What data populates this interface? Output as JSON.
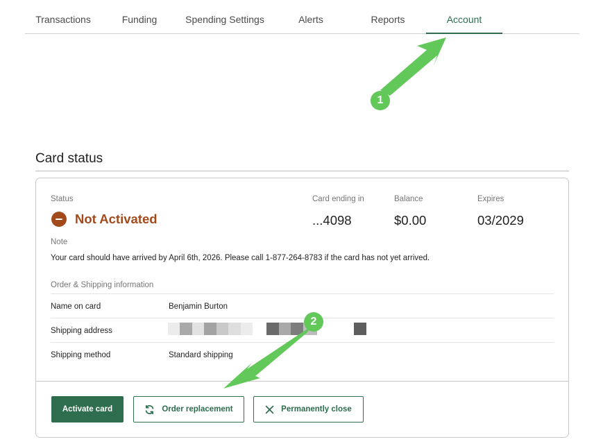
{
  "tabs": [
    {
      "label": "Transactions"
    },
    {
      "label": "Funding"
    },
    {
      "label": "Spending Settings"
    },
    {
      "label": "Alerts"
    },
    {
      "label": "Reports"
    },
    {
      "label": "Account",
      "active": true
    }
  ],
  "section_title": "Card status",
  "card": {
    "status_label": "Status",
    "status_value": "Not Activated",
    "card_ending_label": "Card ending in",
    "card_ending_value": "...4098",
    "balance_label": "Balance",
    "balance_value": "$0.00",
    "expires_label": "Expires",
    "expires_value": "03/2029",
    "note_label": "Note",
    "note_text": "Your card should have arrived by April 6th, 2026. Please call 1-877-264-8783 if the card has not yet arrived.",
    "order_label": "Order & Shipping information",
    "rows": [
      {
        "key": "Name on card",
        "value": "Benjamin Burton"
      },
      {
        "key": "Shipping address",
        "value": ""
      },
      {
        "key": "Shipping method",
        "value": "Standard shipping"
      }
    ]
  },
  "buttons": {
    "activate": "Activate card",
    "replace": "Order replacement",
    "close": "Permanently close"
  },
  "annotations": {
    "step1": "1",
    "step2": "2"
  },
  "colors": {
    "accent_green": "#2e6e4e",
    "status_orange": "#a24a1c",
    "annotation_green": "#62c85a"
  }
}
